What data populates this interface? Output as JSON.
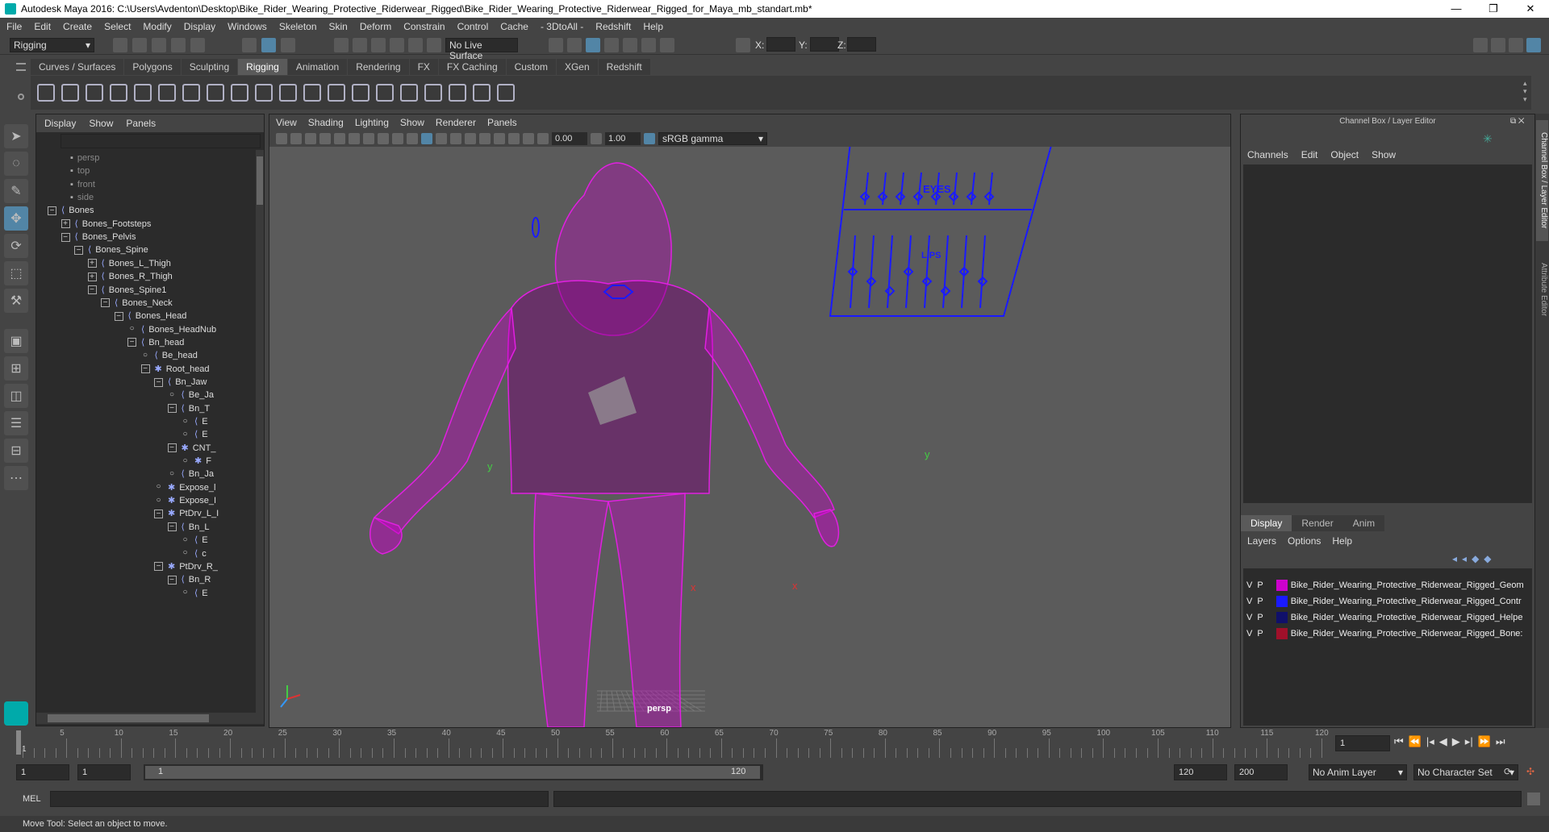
{
  "window": {
    "title": "Autodesk Maya 2016: C:\\Users\\Avdenton\\Desktop\\Bike_Rider_Wearing_Protective_Riderwear_Rigged\\Bike_Rider_Wearing_Protective_Riderwear_Rigged_for_Maya_mb_standart.mb*",
    "minimize": "—",
    "maximize": "❐",
    "close": "✕"
  },
  "menubar": [
    "File",
    "Edit",
    "Create",
    "Select",
    "Modify",
    "Display",
    "Windows",
    "Skeleton",
    "Skin",
    "Deform",
    "Constrain",
    "Control",
    "Cache",
    "- 3DtoAll -",
    "Redshift",
    "Help"
  ],
  "status": {
    "menuset": "Rigging",
    "live_surface": "No Live Surface",
    "x_label": "X:",
    "y_label": "Y:",
    "z_label": "Z:"
  },
  "shelf_tabs": [
    "Curves / Surfaces",
    "Polygons",
    "Sculpting",
    "Rigging",
    "Animation",
    "Rendering",
    "FX",
    "FX Caching",
    "Custom",
    "XGen",
    "Redshift"
  ],
  "shelf_active": "Rigging",
  "outliner": {
    "menu": [
      "Display",
      "Show",
      "Panels"
    ],
    "rows": [
      {
        "label": "persp",
        "indent": 0,
        "type": "cam",
        "dim": true
      },
      {
        "label": "top",
        "indent": 0,
        "type": "cam",
        "dim": true
      },
      {
        "label": "front",
        "indent": 0,
        "type": "cam",
        "dim": true
      },
      {
        "label": "side",
        "indent": 0,
        "type": "cam",
        "dim": true
      },
      {
        "label": "Bones",
        "indent": 0,
        "exp": "−",
        "type": "bone"
      },
      {
        "label": "Bones_Footsteps",
        "indent": 1,
        "exp": "+",
        "type": "bone"
      },
      {
        "label": "Bones_Pelvis",
        "indent": 1,
        "exp": "−",
        "type": "bone"
      },
      {
        "label": "Bones_Spine",
        "indent": 2,
        "exp": "−",
        "type": "bone"
      },
      {
        "label": "Bones_L_Thigh",
        "indent": 3,
        "exp": "+",
        "type": "bone"
      },
      {
        "label": "Bones_R_Thigh",
        "indent": 3,
        "exp": "+",
        "type": "bone"
      },
      {
        "label": "Bones_Spine1",
        "indent": 3,
        "exp": "−",
        "type": "bone"
      },
      {
        "label": "Bones_Neck",
        "indent": 4,
        "exp": "−",
        "type": "bone"
      },
      {
        "label": "Bones_Head",
        "indent": 5,
        "exp": "−",
        "type": "bone"
      },
      {
        "label": "Bones_HeadNub",
        "indent": 6,
        "exp": "o",
        "type": "bone"
      },
      {
        "label": "Bn_head",
        "indent": 6,
        "exp": "−",
        "type": "bone"
      },
      {
        "label": "Be_head",
        "indent": 7,
        "exp": "o",
        "type": "bone"
      },
      {
        "label": "Root_head",
        "indent": 7,
        "exp": "−",
        "type": "star"
      },
      {
        "label": "Bn_Jaw",
        "indent": 8,
        "exp": "−",
        "type": "bone"
      },
      {
        "label": "Be_Ja",
        "indent": 9,
        "exp": "o",
        "type": "bone"
      },
      {
        "label": "Bn_T",
        "indent": 9,
        "exp": "−",
        "type": "bone"
      },
      {
        "label": "E",
        "indent": 10,
        "exp": "o",
        "type": "bone"
      },
      {
        "label": "E",
        "indent": 10,
        "exp": "o",
        "type": "bone"
      },
      {
        "label": "CNT_",
        "indent": 9,
        "exp": "−",
        "type": "star"
      },
      {
        "label": "F",
        "indent": 10,
        "exp": "o",
        "type": "star"
      },
      {
        "label": "Bn_Ja",
        "indent": 9,
        "exp": "o",
        "type": "bone"
      },
      {
        "label": "Expose_l",
        "indent": 8,
        "exp": "o",
        "type": "star"
      },
      {
        "label": "Expose_I",
        "indent": 8,
        "exp": "o",
        "type": "star"
      },
      {
        "label": "PtDrv_L_I",
        "indent": 8,
        "exp": "−",
        "type": "star"
      },
      {
        "label": "Bn_L",
        "indent": 9,
        "exp": "−",
        "type": "bone"
      },
      {
        "label": "E",
        "indent": 10,
        "exp": "o",
        "type": "bone"
      },
      {
        "label": "c",
        "indent": 10,
        "exp": "o",
        "type": "bone"
      },
      {
        "label": "PtDrv_R_",
        "indent": 8,
        "exp": "−",
        "type": "star"
      },
      {
        "label": "Bn_R",
        "indent": 9,
        "exp": "−",
        "type": "bone"
      },
      {
        "label": "E",
        "indent": 10,
        "exp": "o",
        "type": "bone"
      }
    ]
  },
  "viewport": {
    "menu": [
      "View",
      "Shading",
      "Lighting",
      "Show",
      "Renderer",
      "Panels"
    ],
    "exposure": "0.00",
    "gamma": "1.00",
    "color_space": "sRGB gamma",
    "camera_label": "persp",
    "face_panel": {
      "eyes": "EYES",
      "lips": "LIPS"
    },
    "axis_y": "y",
    "axis_x": "x"
  },
  "channelbox": {
    "title": "Channel Box / Layer Editor",
    "menu": [
      "Channels",
      "Edit",
      "Object",
      "Show"
    ],
    "tabs": [
      "Display",
      "Render",
      "Anim"
    ],
    "active_tab": "Display",
    "layer_menu": [
      "Layers",
      "Options",
      "Help"
    ],
    "layers": [
      {
        "v": "V",
        "p": "P",
        "color": "#cc00cc",
        "name": "Bike_Rider_Wearing_Protective_Riderwear_Rigged_Geom"
      },
      {
        "v": "V",
        "p": "P",
        "color": "#1a1aff",
        "name": "Bike_Rider_Wearing_Protective_Riderwear_Rigged_Contr"
      },
      {
        "v": "V",
        "p": "P",
        "color": "#10106a",
        "name": "Bike_Rider_Wearing_Protective_Riderwear_Rigged_Helpe"
      },
      {
        "v": "V",
        "p": "P",
        "color": "#a0102a",
        "name": "Bike_Rider_Wearing_Protective_Riderwear_Rigged_Bone:"
      }
    ],
    "side_tabs": [
      "Channel Box / Layer Editor",
      "Attribute Editor"
    ]
  },
  "timeline": {
    "ticks": [
      "5",
      "10",
      "15",
      "20",
      "25",
      "30",
      "35",
      "40",
      "45",
      "50",
      "55",
      "60",
      "65",
      "70",
      "75",
      "80",
      "85",
      "90",
      "95",
      "100",
      "105",
      "110",
      "115",
      "120"
    ],
    "current_frame": "1",
    "left_marker": "1"
  },
  "range": {
    "start": "1",
    "playback_start": "1",
    "slider_start": "1",
    "slider_end": "120",
    "playback_end": "120",
    "end": "200",
    "anim_layer": "No Anim Layer",
    "character_set": "No Character Set"
  },
  "cmdline": {
    "label": "MEL"
  },
  "helpline": {
    "text": "Move Tool: Select an object to move."
  },
  "colors": {
    "wire": "#e020e0",
    "controls": "#1a1aff",
    "accent": "#5285a6"
  }
}
